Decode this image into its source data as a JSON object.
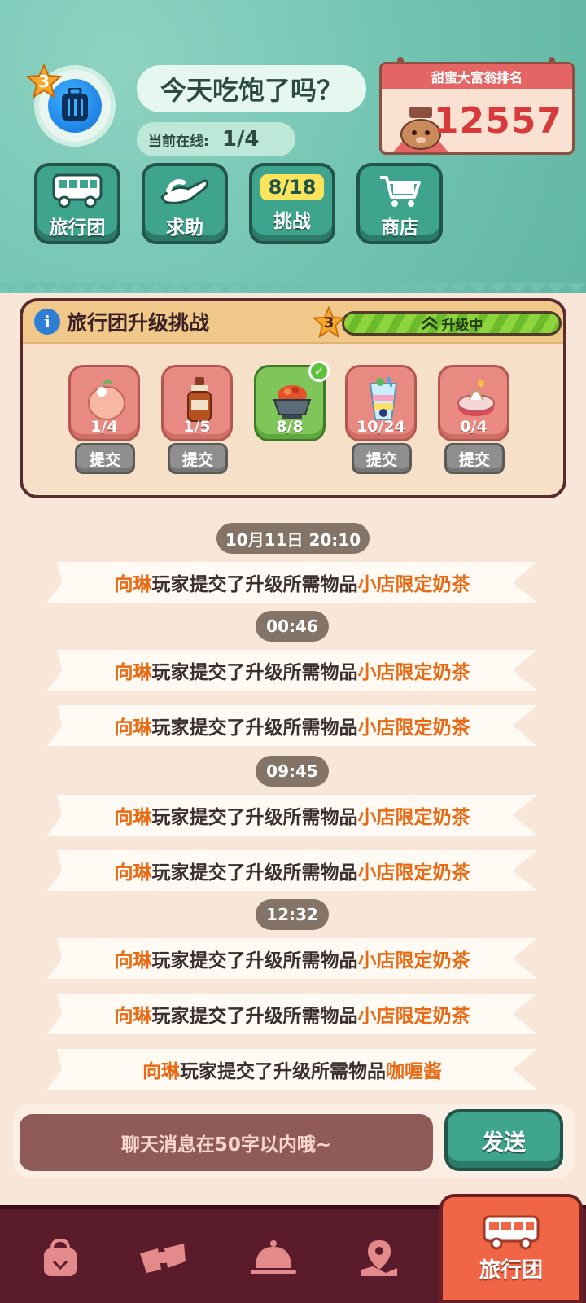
{
  "header": {
    "player_level": "3",
    "greeting": "今天吃饱了吗？",
    "online_label": "当前在线:",
    "online_value": "1/4",
    "ranking": {
      "title": "甜蜜大富翁排名",
      "score": "12557"
    }
  },
  "top_nav": [
    {
      "label": "旅行团",
      "icon": "bus-icon"
    },
    {
      "label": "求助",
      "icon": "helping-hand-icon"
    },
    {
      "label": "挑战",
      "badge": "8/18",
      "icon": "challenge-badge"
    },
    {
      "label": "商店",
      "icon": "cart-icon"
    }
  ],
  "challenge": {
    "title": "旅行团升级挑战",
    "level": "3",
    "status": "升级中",
    "progress": 1.0,
    "items": [
      {
        "name": "shaved-ice-dessert",
        "count": "1/4",
        "submit": "提交",
        "done": false
      },
      {
        "name": "sauce-bottle",
        "count": "1/5",
        "submit": "提交",
        "done": false
      },
      {
        "name": "hotpot-bowl",
        "count": "8/8",
        "done": true
      },
      {
        "name": "parfait-cup",
        "count": "10/24",
        "submit": "提交",
        "done": false
      },
      {
        "name": "cake-slice",
        "count": "0/4",
        "submit": "提交",
        "done": false
      }
    ]
  },
  "chat": {
    "timestamps": [
      "10月11日 20:10",
      "00:46",
      "09:45",
      "12:32"
    ],
    "messages": [
      {
        "user": "向琳",
        "text": "玩家提交了升级所需物品",
        "item": "小店限定奶茶"
      },
      {
        "user": "向琳",
        "text": "玩家提交了升级所需物品",
        "item": "小店限定奶茶"
      },
      {
        "user": "向琳",
        "text": "玩家提交了升级所需物品",
        "item": "小店限定奶茶"
      },
      {
        "user": "向琳",
        "text": "玩家提交了升级所需物品",
        "item": "小店限定奶茶"
      },
      {
        "user": "向琳",
        "text": "玩家提交了升级所需物品",
        "item": "小店限定奶茶"
      },
      {
        "user": "向琳",
        "text": "玩家提交了升级所需物品",
        "item": "小店限定奶茶"
      },
      {
        "user": "向琳",
        "text": "玩家提交了升级所需物品",
        "item": "小店限定奶茶"
      },
      {
        "user": "向琳",
        "text": "玩家提交了升级所需物品",
        "item": "咖喱酱"
      }
    ],
    "input_placeholder": "聊天消息在50字以内哦~",
    "send_label": "发送"
  },
  "bottom_nav": {
    "tabs": [
      "bag-icon",
      "ribbon-icon",
      "cloche-icon",
      "map-pin-icon"
    ],
    "active_label": "旅行团"
  },
  "colors": {
    "teal": "#6fc2b0",
    "button_teal": "#3fa48e",
    "highlight_orange": "#ea6a13",
    "panel_border": "#5a2a2f",
    "nav_bg": "#5a1c2a",
    "active_tab": "#ef6546"
  }
}
